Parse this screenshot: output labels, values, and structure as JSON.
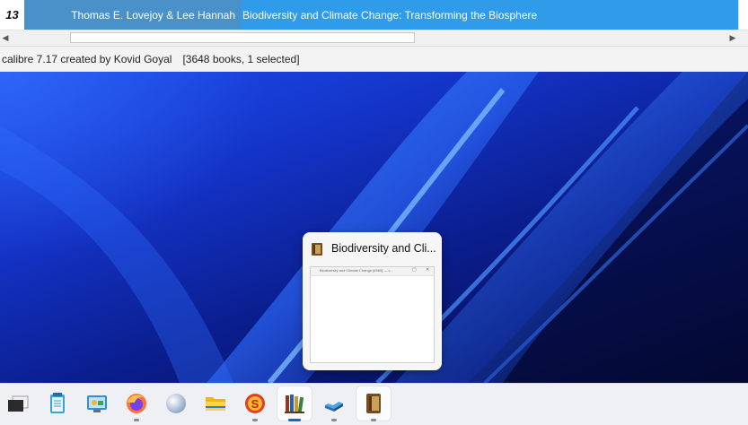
{
  "booklist": {
    "row_number": "13",
    "author": "Thomas E. Lovejoy & Lee Hannah",
    "title": "Biodiversity and Climate Change: Transforming the Biosphere"
  },
  "statusbar": {
    "version": "calibre 7.17 created by Kovid Goyal",
    "counts": "[3648 books, 1 selected]"
  },
  "preview": {
    "title": "Biodiversity and Cli...",
    "mini_title": "Biodiversity and Climate Change [#560] — c..."
  },
  "taskbar": {
    "items": [
      {
        "icon": "task-view-icon",
        "running": false
      },
      {
        "icon": "notepad-icon",
        "running": false
      },
      {
        "icon": "control-panel-icon",
        "running": false
      },
      {
        "icon": "firefox-icon",
        "running": true
      },
      {
        "icon": "orb-app-icon",
        "running": false
      },
      {
        "icon": "file-explorer-icon",
        "running": false
      },
      {
        "icon": "app-s-icon",
        "running": true
      },
      {
        "icon": "calibre-library-icon",
        "running": true,
        "active": true
      },
      {
        "icon": "calibre-ebook-viewer-icon",
        "running": true
      },
      {
        "icon": "calibre-book-icon",
        "running": true
      }
    ]
  },
  "colors": {
    "selection_author": "#4a90c9",
    "selection_title": "#2f9be9",
    "taskbar_active_indicator": "#1a5fd8",
    "wallpaper_base": "#0a1c8a"
  }
}
